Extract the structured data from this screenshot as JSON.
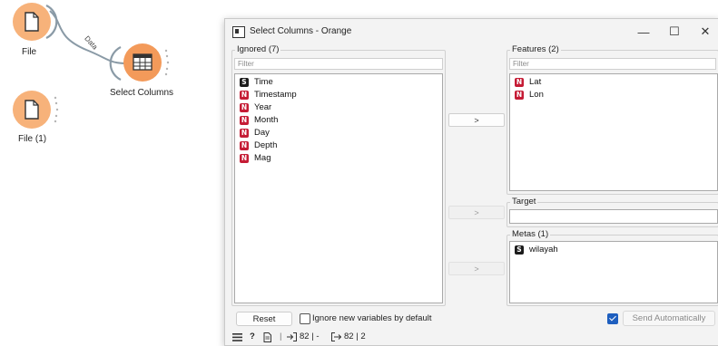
{
  "canvas": {
    "nodes": [
      {
        "label": "File",
        "icon": "file-doc-icon"
      },
      {
        "label": "Select Columns",
        "icon": "select-columns-icon"
      },
      {
        "label": "File (1)",
        "icon": "file-doc-icon"
      }
    ],
    "link_label": "Data"
  },
  "window": {
    "title": "Select Columns - Orange",
    "controls": {
      "minimize": "—",
      "maximize": "☐",
      "close": "✕"
    }
  },
  "ignored": {
    "label": "Ignored (7)",
    "filter_placeholder": "Filter",
    "items": [
      {
        "name": "Time",
        "type": "S"
      },
      {
        "name": "Timestamp",
        "type": "N"
      },
      {
        "name": "Year",
        "type": "N"
      },
      {
        "name": "Month",
        "type": "N"
      },
      {
        "name": "Day",
        "type": "N"
      },
      {
        "name": "Depth",
        "type": "N"
      },
      {
        "name": "Mag",
        "type": "N"
      }
    ]
  },
  "features": {
    "label": "Features (2)",
    "filter_placeholder": "Filter",
    "items": [
      {
        "name": "Lat",
        "type": "N"
      },
      {
        "name": "Lon",
        "type": "N"
      }
    ]
  },
  "target": {
    "label": "Target",
    "value": ""
  },
  "metas": {
    "label": "Metas (1)",
    "items": [
      {
        "name": "wilayah",
        "type": "S"
      }
    ]
  },
  "buttons": {
    "move_features": ">",
    "move_target": ">",
    "move_metas": ">",
    "reset": "Reset",
    "send_automatically": "Send Automatically"
  },
  "options": {
    "ignore_new_label": "Ignore new variables by default",
    "ignore_new_checked": false,
    "auto_send_checked": true
  },
  "statusbar": {
    "input_summary": "82 | -",
    "output_summary": "82 | 2"
  },
  "colors": {
    "numeric_badge": "#c51c35",
    "string_badge": "#1c1c1c",
    "node_orange": "#f7b27a",
    "accent_blue": "#1e5fbf"
  }
}
